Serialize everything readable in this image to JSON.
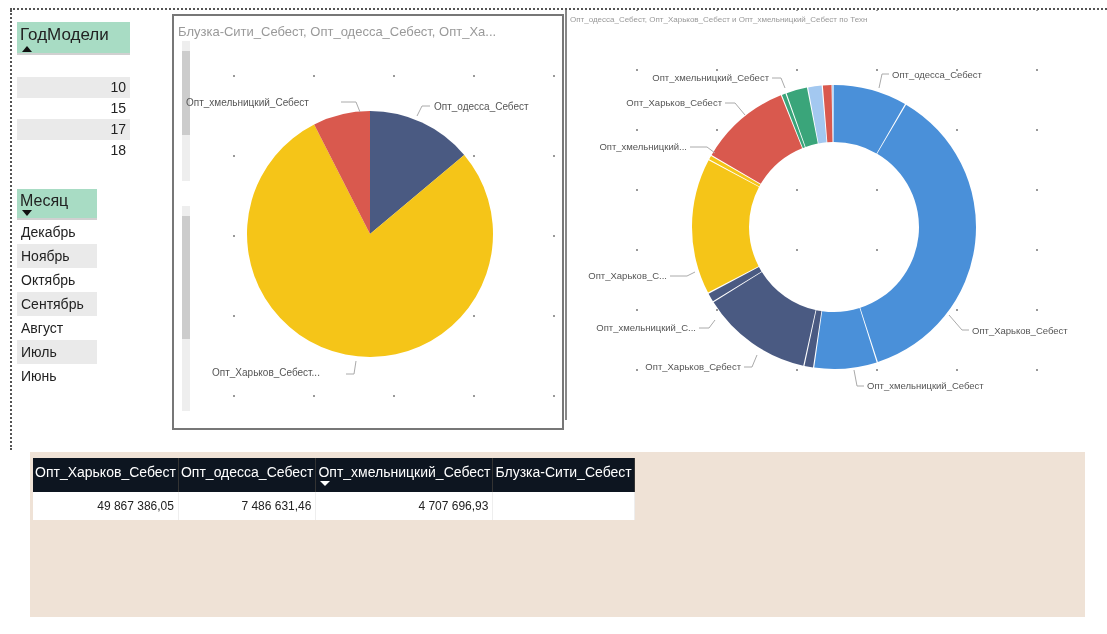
{
  "year_slicer": {
    "title": "ГодМодели",
    "items": [
      "10",
      "15",
      "17",
      "18"
    ]
  },
  "month_slicer": {
    "title": "Месяц",
    "items": [
      "Декабрь",
      "Ноябрь",
      "Октябрь",
      "Сентябрь",
      "Август",
      "Июль",
      "Июнь"
    ]
  },
  "pie_chart": {
    "title": "Блузка-Сити_Себест, Опт_одесса_Себест, Опт_Ха...",
    "labels": [
      "Опт_хмельницкий_Себест",
      "Опт_одесса_Себест",
      "Опт_Харьков_Себест..."
    ]
  },
  "donut_chart": {
    "title": "Опт_одесса_Себест, Опт_Харьков_Себест и Опт_хмельницкий_Себест по Техн",
    "labels": [
      "Опт_хмельницкий_Себест",
      "Опт_одесса_Себест",
      "Опт_Харьков_Себест",
      "Опт_хмельницкий...",
      "Опт_Харьков_С...",
      "Опт_хмельницкий_С...",
      "Опт_Харьков_Себест",
      "Опт_Харьков_Себест",
      "Опт_хмельницкий_Себест"
    ]
  },
  "table": {
    "columns": [
      {
        "label": "Опт_Харьков_Себест",
        "sorted": false
      },
      {
        "label": "Опт_одесса_Себест",
        "sorted": false
      },
      {
        "label": "Опт_хмельницкий_Себест",
        "sorted": true
      },
      {
        "label": "Блузка-Сити_Себест",
        "sorted": false
      }
    ],
    "rows": [
      [
        "49 867 386,05",
        "7 486 631,46",
        "4 707 696,93"
      ]
    ]
  }
}
